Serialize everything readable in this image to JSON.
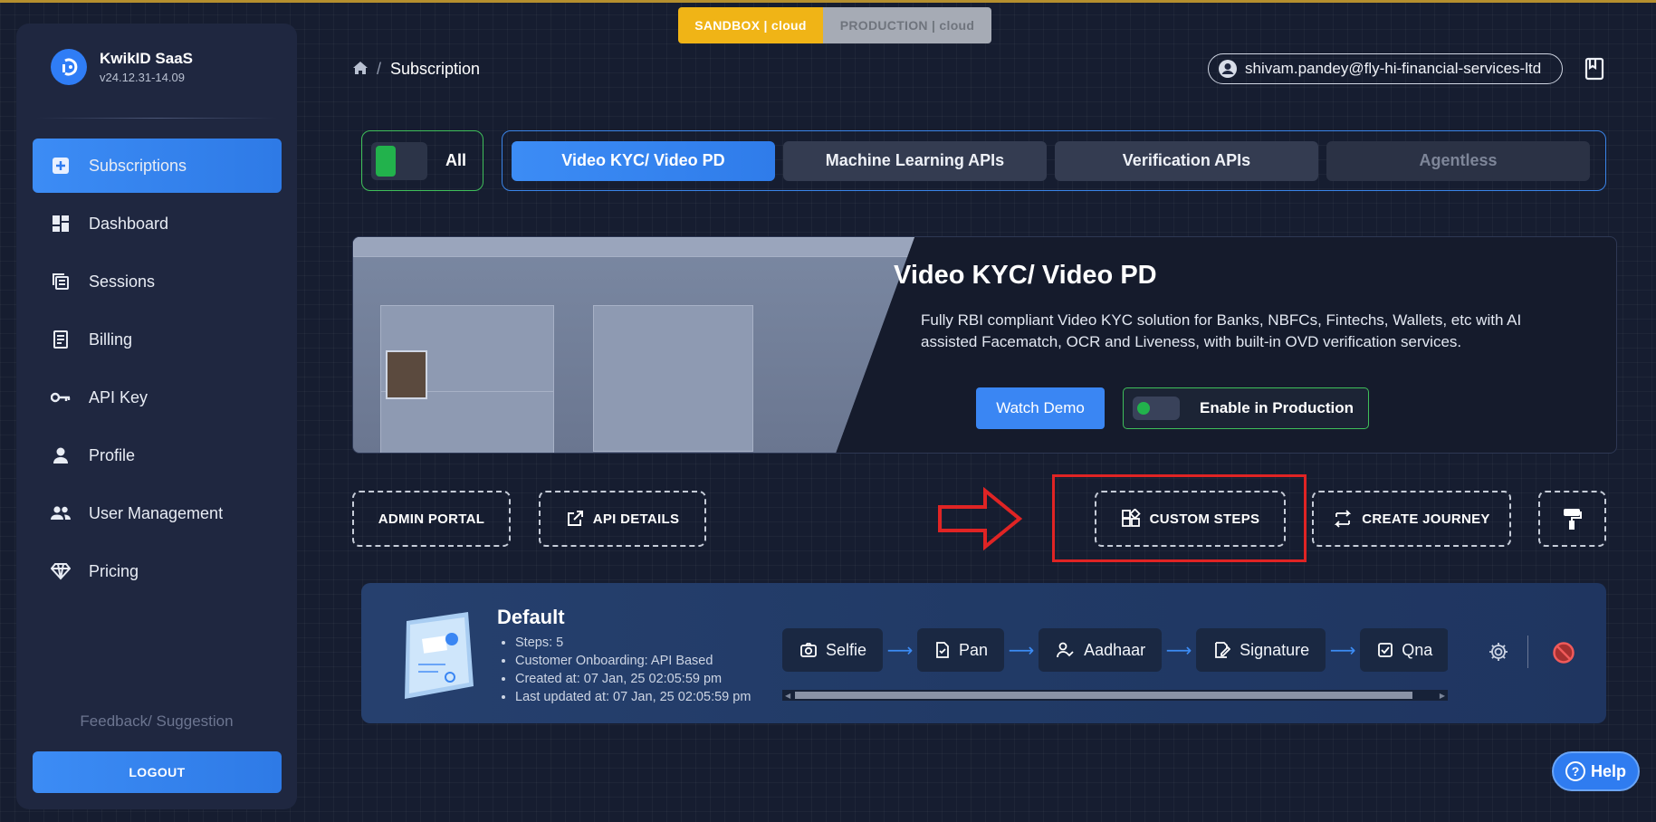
{
  "env": {
    "sandbox": "SANDBOX | cloud",
    "production": "PRODUCTION | cloud"
  },
  "brand": {
    "name": "KwikID SaaS",
    "version": "v24.12.31-14.09"
  },
  "sidebar": {
    "items": [
      {
        "label": "Subscriptions",
        "icon": "plus-square-icon",
        "active": true
      },
      {
        "label": "Dashboard",
        "icon": "dashboard-icon"
      },
      {
        "label": "Sessions",
        "icon": "sessions-icon"
      },
      {
        "label": "Billing",
        "icon": "billing-icon"
      },
      {
        "label": "API Key",
        "icon": "key-icon"
      },
      {
        "label": "Profile",
        "icon": "person-icon"
      },
      {
        "label": "User Management",
        "icon": "users-icon"
      },
      {
        "label": "Pricing",
        "icon": "diamond-icon"
      }
    ],
    "feedback": "Feedback/ Suggestion",
    "logout": "LOGOUT"
  },
  "header": {
    "breadcrumb_current": "Subscription",
    "user_email": "shivam.pandey@fly-hi-financial-services-ltd"
  },
  "filters": {
    "all_label": "All",
    "tabs": [
      {
        "label": "Video KYC/ Video PD",
        "state": "active"
      },
      {
        "label": "Machine Learning APIs",
        "state": "normal"
      },
      {
        "label": "Verification APIs",
        "state": "normal"
      },
      {
        "label": "Agentless",
        "state": "disabled"
      }
    ]
  },
  "product": {
    "title": "Video KYC/ Video PD",
    "description": "Fully RBI compliant Video KYC solution for Banks, NBFCs, Fintechs, Wallets, etc with AI assisted Facematch, OCR and Liveness, with built-in OVD verification services.",
    "watch_demo": "Watch Demo",
    "enable_production": "Enable in Production"
  },
  "actions": {
    "admin_portal": "ADMIN PORTAL",
    "api_details": "API DETAILS",
    "custom_steps": "CUSTOM STEPS",
    "create_journey": "CREATE JOURNEY"
  },
  "journey": {
    "title": "Default",
    "meta": [
      "Steps: 5",
      "Customer Onboarding: API Based",
      "Created at: 07 Jan, 25 02:05:59 pm",
      "Last updated at: 07 Jan, 25 02:05:59 pm"
    ],
    "steps": [
      "Selfie",
      "Pan",
      "Aadhaar",
      "Signature",
      "Qna"
    ]
  },
  "help": "Help",
  "colors": {
    "accent": "#2f7cf0",
    "sandbox": "#f0b416",
    "success": "#22b24c",
    "highlight": "#e02424"
  }
}
